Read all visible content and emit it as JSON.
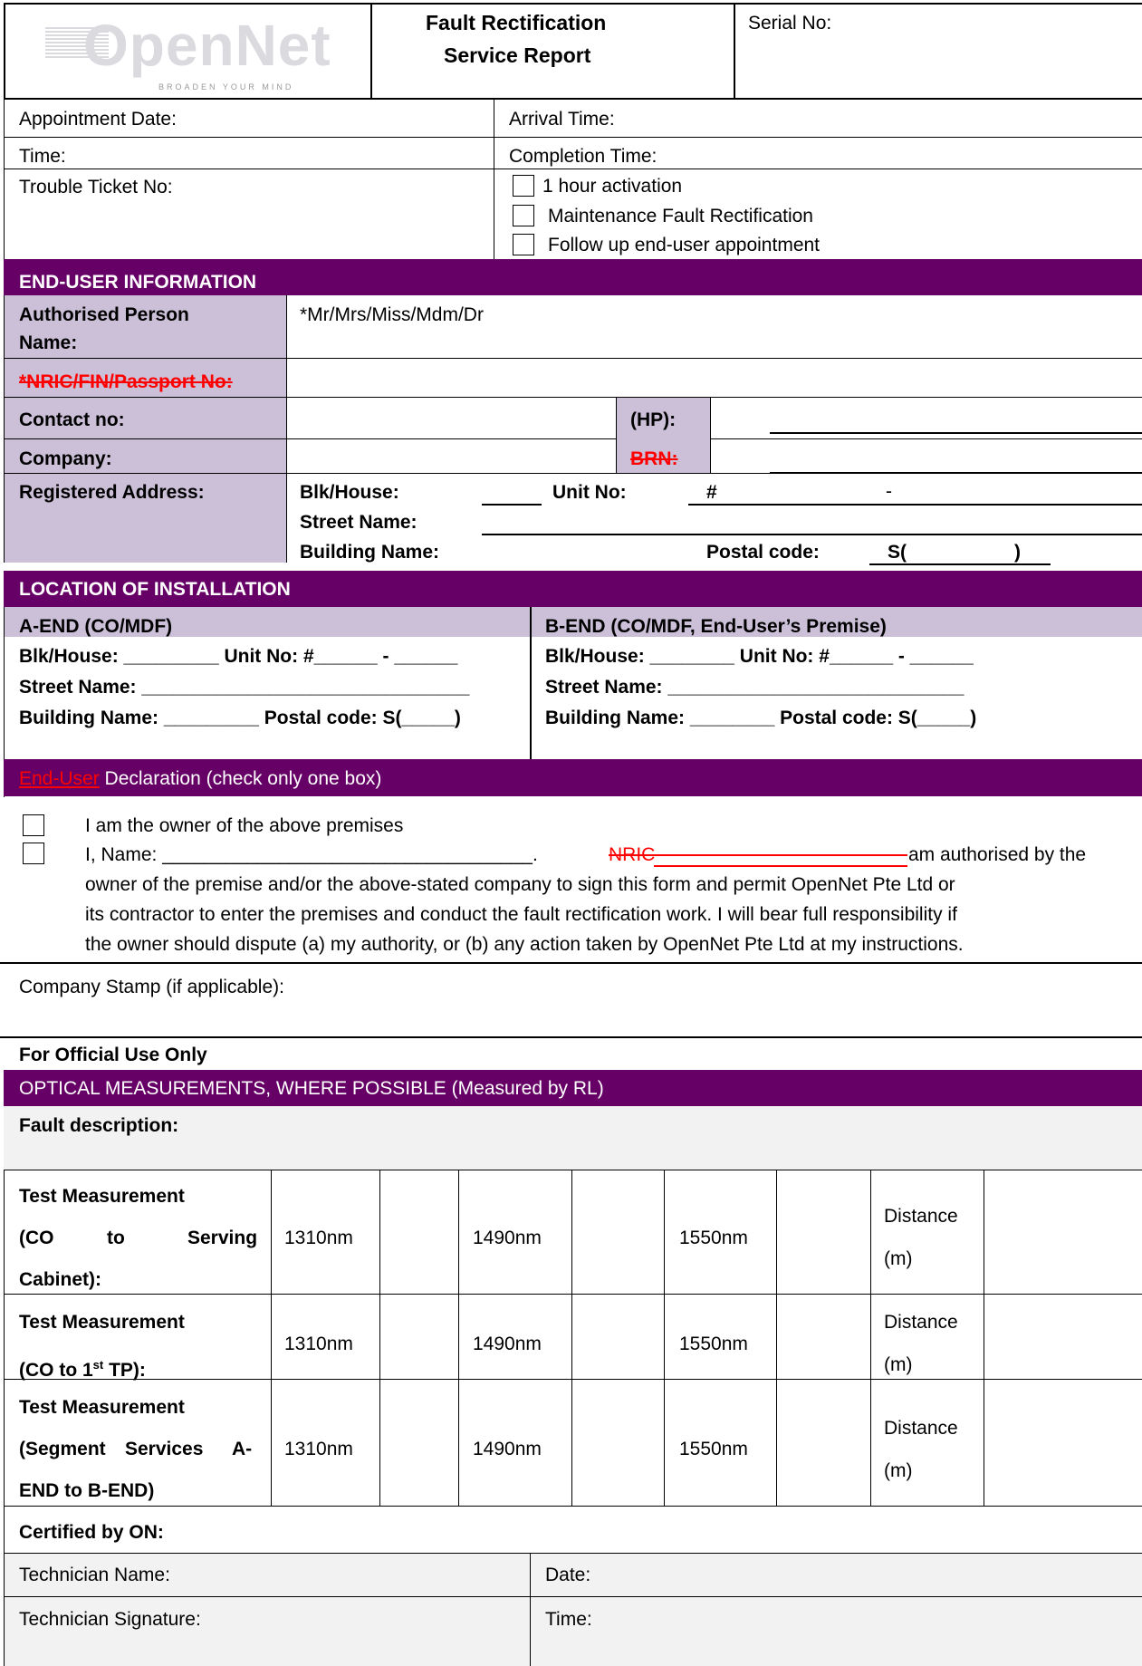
{
  "header": {
    "logo_text": "OpenNet",
    "logo_tagline": "BROADEN YOUR MIND",
    "title_line1": "Fault Rectification",
    "title_line2": "Service Report",
    "serial_label": "Serial No:"
  },
  "appointment": {
    "appointment_date": "Appointment Date:",
    "arrival_time": "Arrival Time:",
    "time": "Time:",
    "completion_time": "Completion Time:",
    "trouble_ticket": "Trouble Ticket No:",
    "options": [
      "1 hour activation",
      "Maintenance Fault Rectification",
      "Follow up end-user appointment"
    ]
  },
  "end_user": {
    "section_title": "END-USER INFORMATION",
    "auth_name_l1": "Authorised Person",
    "auth_name_l2": "Name:",
    "salutation": "*Mr/Mrs/Miss/Mdm/Dr",
    "nric": "*NRIC/FIN/Passport No:",
    "contact": "Contact no:",
    "hp": "(HP):",
    "company": "Company:",
    "brn": "BRN:",
    "reg_address": "Registered Address:",
    "blk_house": "Blk/House:",
    "unit_no": "Unit No:",
    "hash": "#",
    "dash": "-",
    "street_name": "Street Name:",
    "building_name": "Building Name:",
    "postal_code": "Postal code:",
    "postal_open": "S(",
    "postal_close": ")"
  },
  "location": {
    "section_title": "LOCATION OF INSTALLATION",
    "a_end_title": "A-END (CO/MDF)",
    "b_end_title": "B-END (CO/MDF, End-User’s Premise)",
    "a_line1": "Blk/House: _________ Unit No: #______ - ______",
    "a_line2": "Street Name: _______________________________",
    "a_line3": "Building Name: _________ Postal code: S(_____)",
    "b_line1": "Blk/House: ________ Unit No: #______ - ______",
    "b_line2": "Street Name: ____________________________",
    "b_line3": "Building Name: ________ Postal code: S(_____)"
  },
  "declaration": {
    "title_red": "End-User",
    "title_rest": " Declaration (check only one box)",
    "owner": "I am the owner of the above premises",
    "line2_a": "I, Name: ___________________________________.",
    "line2_nric": "NRIC",
    "line2_b": "am authorised by the",
    "line3": "owner of the premise and/or the above-stated company  to sign this form and permit OpenNet Pte Ltd or",
    "line4": "its contractor to enter the premises and conduct the fault rectification work.  I will bear full responsibility if",
    "line5": "the owner should dispute (a) my authority, or (b) any action taken by OpenNet Pte Ltd at my instructions."
  },
  "stamp": {
    "label": "Company Stamp (if applicable):",
    "official": "For Official Use Only"
  },
  "optical": {
    "section_title": "OPTICAL MEASUREMENTS, WHERE POSSIBLE (Measured by RL)",
    "fault_desc": "Fault description:",
    "rows": [
      {
        "l1": "Test Measurement",
        "l2a": "(CO",
        "l2b": "to",
        "l2c": "Serving",
        "l3": "Cabinet):"
      },
      {
        "l1": "Test Measurement",
        "l2": "(CO to 1",
        "sup": "st",
        "l2end": " TP):"
      },
      {
        "l1": "Test Measurement",
        "l2a": "(Segment",
        "l2b": "Services",
        "l2c": "A-",
        "l3": "END to B-END)"
      }
    ],
    "nm1": "1310nm",
    "nm2": "1490nm",
    "nm3": "1550nm",
    "distance": "Distance",
    "unit_m": "(m)"
  },
  "certification": {
    "certified": "Certified by  ON:",
    "tech_name": "Technician Name:",
    "date": "Date:",
    "tech_sig": "Technician Signature:",
    "time": "Time:"
  },
  "colors": {
    "purple": "#660066",
    "lavender": "#ccc0d9",
    "grey": "#f2f2f2",
    "red": "#ff0000"
  }
}
